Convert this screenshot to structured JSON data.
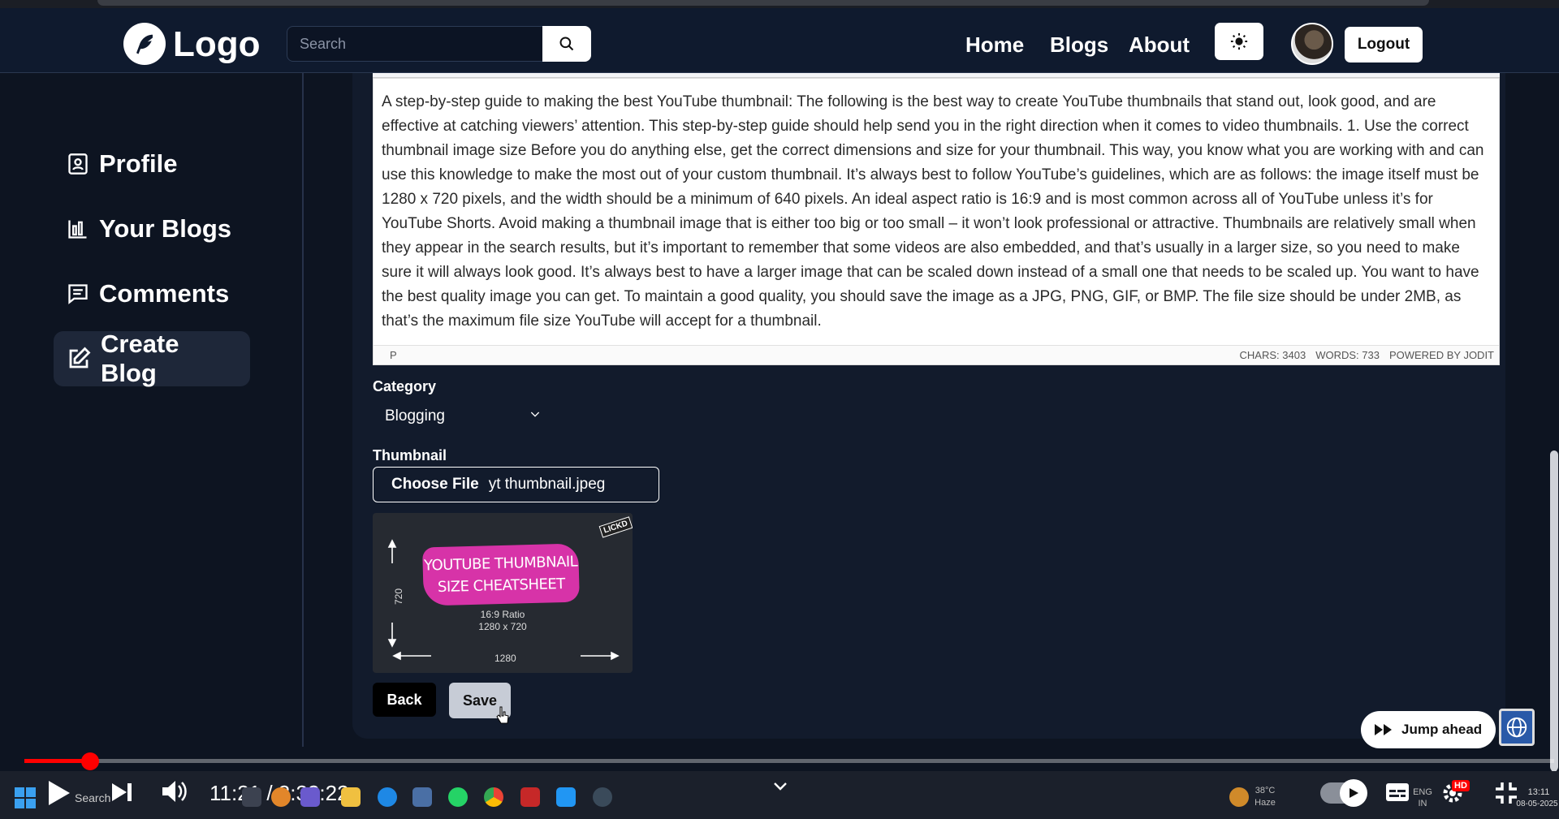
{
  "navbar": {
    "logo_text": "Logo",
    "search_placeholder": "Search",
    "links": {
      "home": "Home",
      "blogs": "Blogs",
      "about": "About"
    },
    "logout": "Logout"
  },
  "sidebar": {
    "items": [
      {
        "label": "Profile"
      },
      {
        "label": "Your Blogs"
      },
      {
        "label": "Comments"
      },
      {
        "label": "Create Blog"
      }
    ]
  },
  "editor": {
    "content": "A step-by-step guide to making the best YouTube thumbnail: The following is the best way to create YouTube thumbnails that stand out, look good, and are effective at catching viewers’ attention. This step-by-step guide should help send you in the right direction when it comes to video thumbnails. 1. Use the correct thumbnail image size Before you do anything else, get the correct dimensions and size for your thumbnail. This way, you know what you are working with and can use this knowledge to make the most out of your custom thumbnail. It’s always best to follow YouTube’s guidelines, which are as follows: the image itself must be 1280 x 720 pixels, and the width should be a minimum of 640 pixels. An ideal aspect ratio is 16:9 and is most common across all of YouTube unless it’s for YouTube Shorts. Avoid making a thumbnail image that is either too big or too small – it won’t look professional or attractive. Thumbnails are relatively small when they appear in the search results, but it’s important to remember that some videos are also embedded, and that’s usually in a larger size, so you need to make sure it will always look good. It’s always best to have a larger image that can be scaled down instead of a small one that needs to be scaled up. You want to have the best quality image you can get. To maintain a good quality, you should save the image as a JPG, PNG, GIF, or BMP. The file size should be under 2MB, as that’s the maximum file size YouTube will accept for a thumbnail.",
    "path": "P",
    "chars": "CHARS: 3403",
    "words": "WORDS: 733",
    "powered": "POWERED BY JODIT"
  },
  "form": {
    "category_label": "Category",
    "category_value": "Blogging",
    "thumbnail_label": "Thumbnail",
    "choose_file": "Choose File",
    "file_name": "yt thumbnail.jpeg",
    "back": "Back",
    "save": "Save"
  },
  "thumbnail_image": {
    "line1": "YOUTUBE THUMBNAIL",
    "line2": "SIZE CHEATSHEET",
    "ratio": "16:9 Ratio",
    "dims": "1280 x 720",
    "width": "1280",
    "height": "720",
    "tag": "LICKD"
  },
  "video": {
    "jump_ahead": "Jump ahead",
    "time": "11:21 / 3:33:22",
    "progress": 0.0432
  },
  "taskbar": {
    "search": "Search",
    "weather_temp": "38°C",
    "weather_desc": "Haze",
    "lang": "ENG",
    "region": "IN",
    "hd": "HD",
    "clock_time": "13:11",
    "clock_date": "08-05-2025"
  }
}
